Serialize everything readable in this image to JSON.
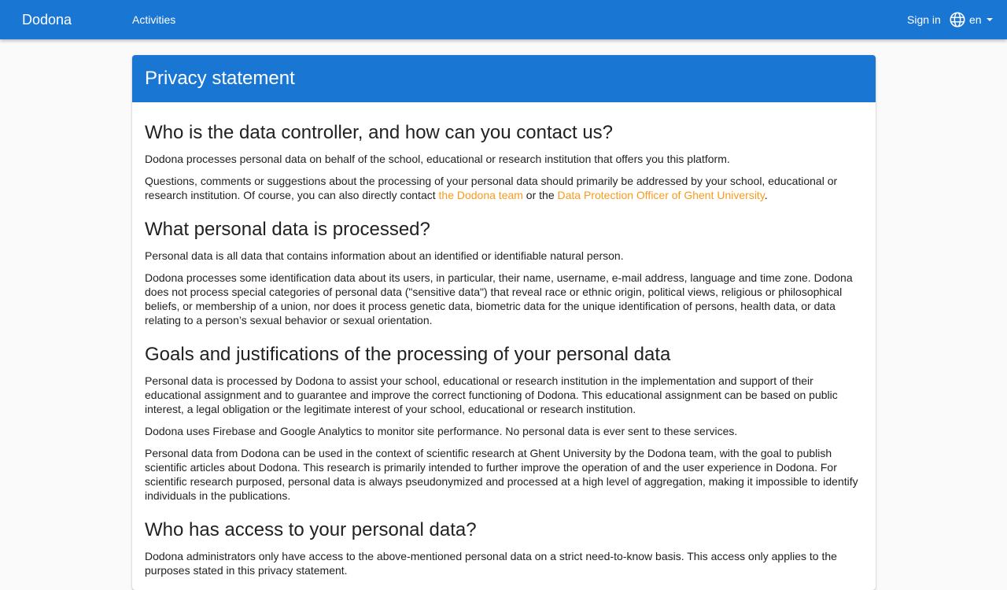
{
  "navbar": {
    "brand": "Dodona",
    "activities": "Activities",
    "sign_in": "Sign in",
    "language": "en",
    "language_icon": "globe-icon",
    "dropdown_icon": "caret-down-icon"
  },
  "colors": {
    "primary": "#1976d2",
    "link": "#f89a1c",
    "background": "#fafafa"
  },
  "page": {
    "title": "Privacy statement"
  },
  "sections": {
    "s1": {
      "heading": "Who is the data controller, and how can you contact us?",
      "p1": "Dodona processes personal data on behalf of the school, educational or research institution that offers you this platform.",
      "p2_before": "Questions, comments or suggestions about the processing of your personal data should primarily be addressed by your school, educational or research institution. Of course, you can also directly contact ",
      "p2_link1": "the Dodona team",
      "p2_middle": " or the ",
      "p2_link2": "Data Protection Officer of Ghent University",
      "p2_after": "."
    },
    "s2": {
      "heading": "What personal data is processed?",
      "p1": "Personal data is all data that contains information about an identified or identifiable natural person.",
      "p2": "Dodona processes some identification data about its users, in particular, their name, username, e-mail address, language and time zone. Dodona does not process special categories of personal data (\"sensitive data\") that reveal race or ethnic origin, political views, religious or philosophical beliefs, or membership of a union, nor does it process genetic data, biometric data for the unique identification of persons, health data, or data relating to a person’s sexual behavior or sexual orientation."
    },
    "s3": {
      "heading": "Goals and justifications of the processing of your personal data",
      "p1": "Personal data is processed by Dodona to assist your school, educational or research institution in the implementation and support of their educational assignment and to guarantee and improve the correct functioning of Dodona. This educational assignment can be based on public interest, a legal obligation or the legitimate interest of your school, educational or research institution.",
      "p2": "Dodona uses Firebase and Google Analytics to monitor site performance. No personal data is ever sent to these services.",
      "p3": "Personal data from Dodona can be used in the context of scientific research at Ghent University by the Dodona team, with the goal to publish scientific articles about Dodona. This research is primarily intended to further improve the operation of and the user experience in Dodona. For scientific research purposed, personal data is always pseudonymized and processed at a high level of aggregation, making it impossible to identify individuals in the publications."
    },
    "s4": {
      "heading": "Who has access to your personal data?",
      "p1": "Dodona administrators only have access to the above-mentioned personal data on a strict need-to-know basis. This access only applies to the purposes stated in this privacy statement."
    }
  }
}
